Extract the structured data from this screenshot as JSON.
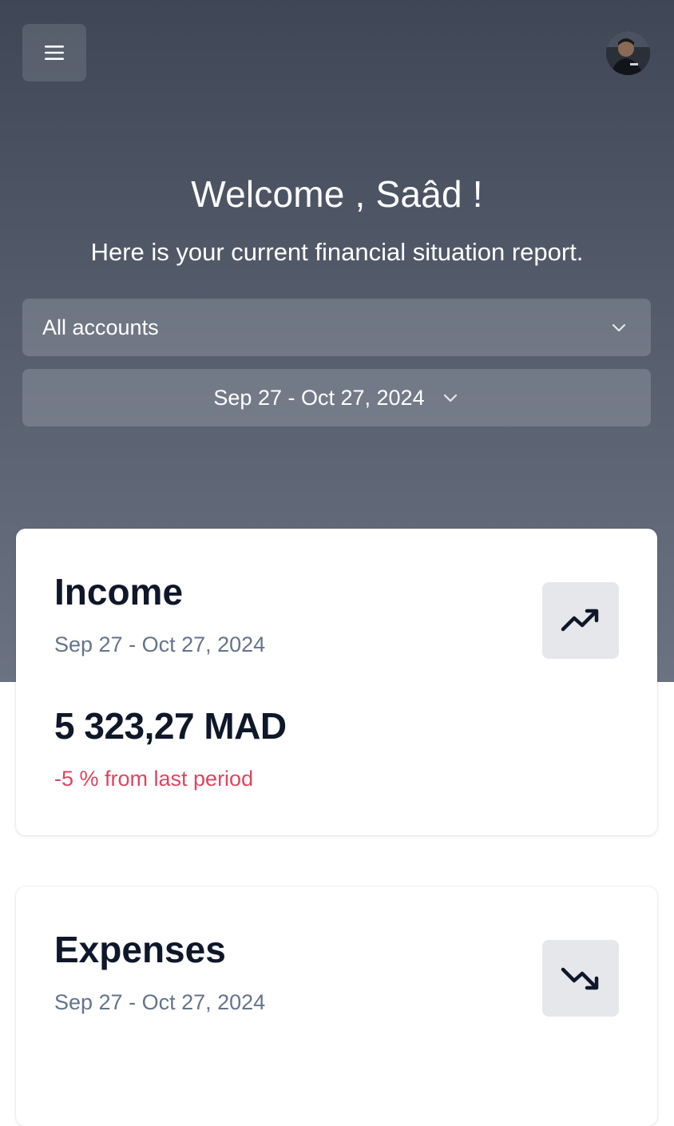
{
  "header": {
    "menu_icon": "hamburger-menu-icon",
    "avatar_icon": "user-avatar"
  },
  "hero": {
    "welcome": "Welcome , Saâd !",
    "subtitle": "Here is your current financial situation report."
  },
  "filters": {
    "account_select": "All accounts",
    "date_range": "Sep 27 - Oct 27, 2024"
  },
  "cards": {
    "income": {
      "title": "Income",
      "date": "Sep 27 - Oct 27, 2024",
      "amount": "5 323,27 MAD",
      "change": "-5 % from last period",
      "icon": "trending-up-icon"
    },
    "expenses": {
      "title": "Expenses",
      "date": "Sep 27 - Oct 27, 2024",
      "icon": "trending-down-icon"
    }
  },
  "colors": {
    "hero_top": "#3f4756",
    "hero_bottom": "#6b7281",
    "negative": "#e0445e",
    "text_dark": "#0f172a",
    "text_muted": "#64748b"
  }
}
